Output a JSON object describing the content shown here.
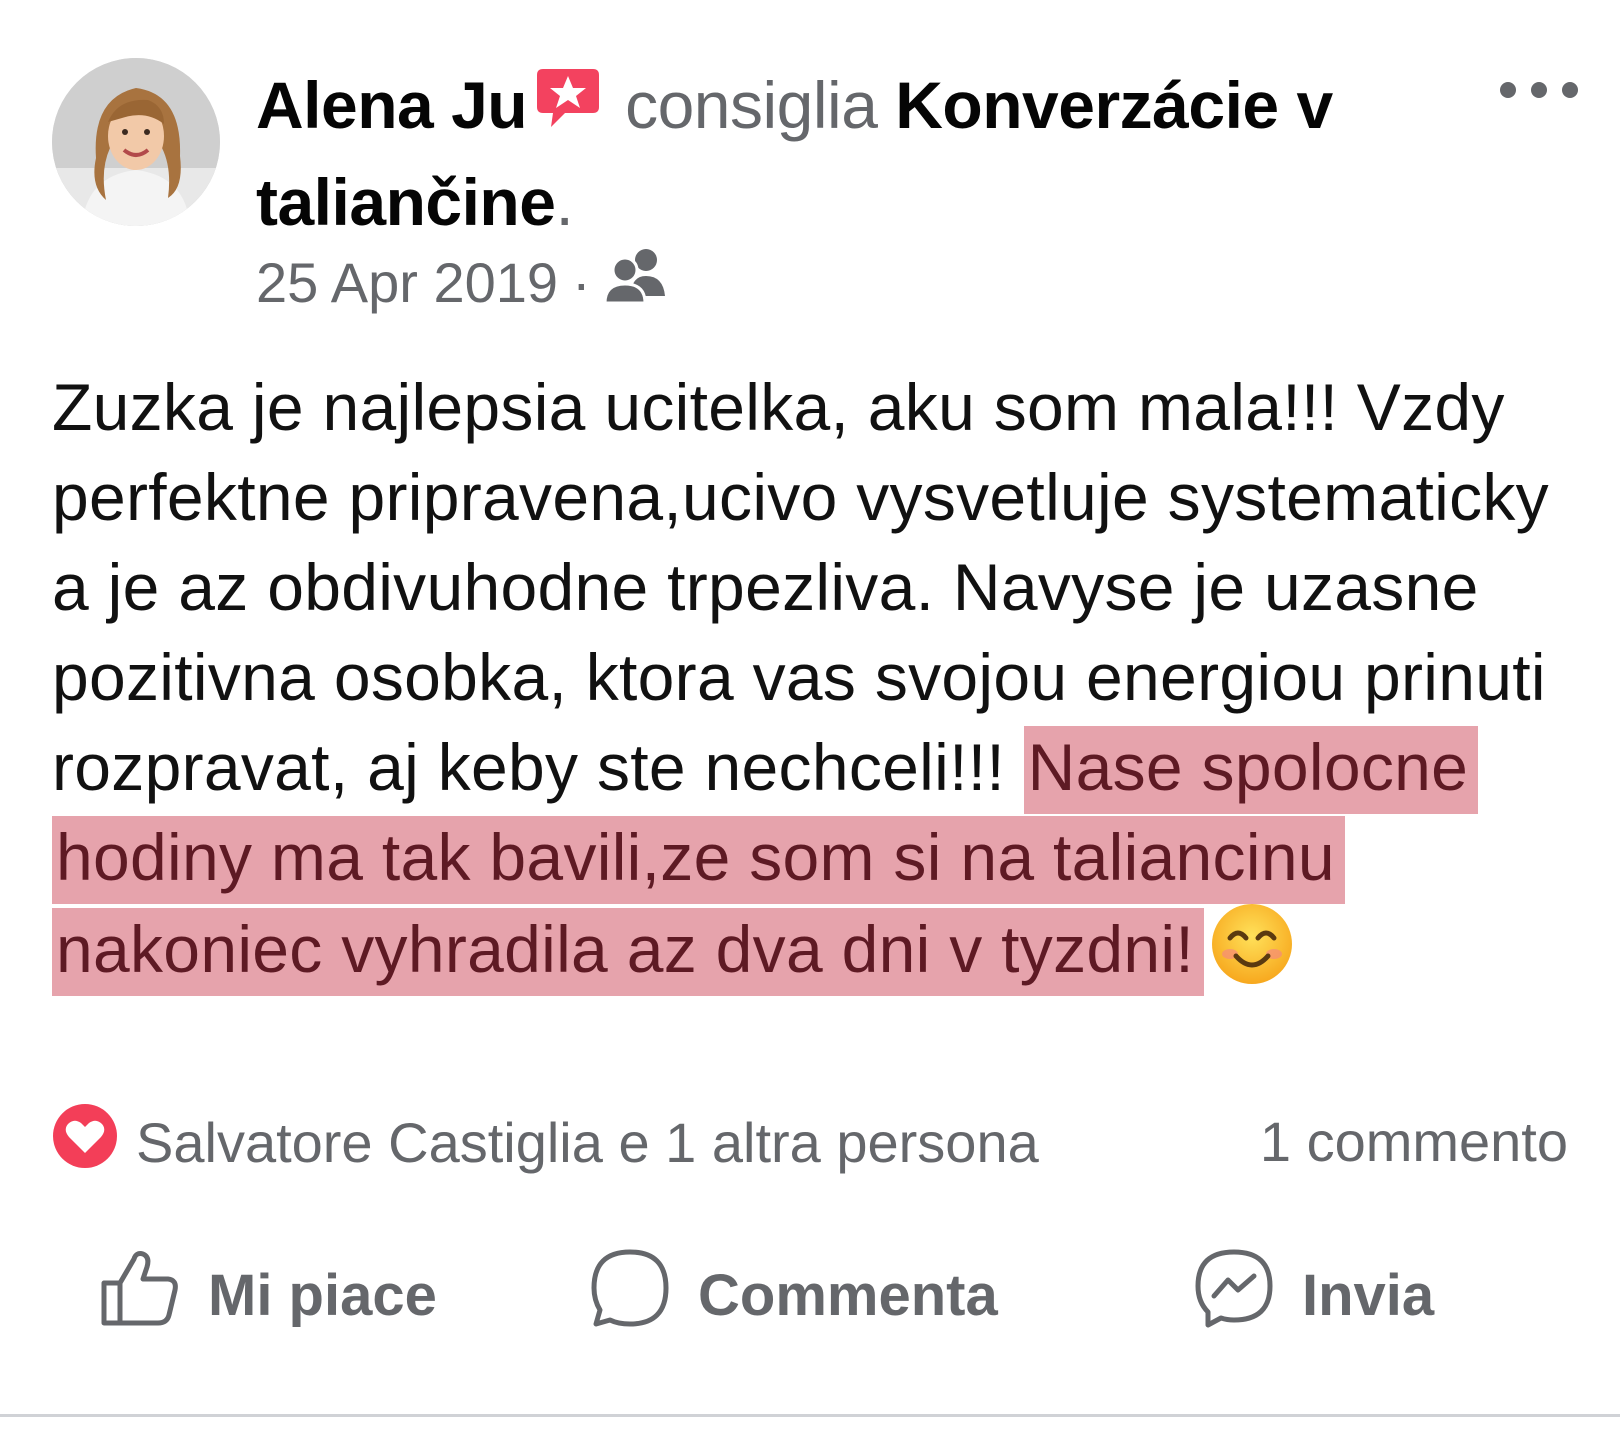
{
  "post": {
    "author": "Alena Ju",
    "verb": "consiglia",
    "page_name": "Konverzácie v taliančine",
    "period": ".",
    "date": "25 Apr 2019",
    "separator": "·",
    "audience_icon": "friends-icon",
    "more_icon": "more-options-icon",
    "body_plain": "Zuzka je najlepsia ucitelka, aku som mala!!! Vzdy perfektne  pripravena,ucivo vysvetluje systematicky a je az obdivuhodne trpezliva. Navyse je uzasne pozitivna osobka, ktora vas svojou energiou prinuti rozpravat, aj keby ste nechceli!!!",
    "body_highlight": "Nase spolocne hodiny ma tak bavili,ze som si na taliancinu nakoniec vyhradila az dva dni v tyzdni!",
    "highlight_color": "#e6a3ac",
    "emoji_icon": "smiling-face-emoji"
  },
  "reactions": {
    "icon": "love-reaction-icon",
    "text": "Salvatore Castiglia e 1 altra persona",
    "comments": "1 commento"
  },
  "actions": {
    "like": "Mi piace",
    "comment": "Commenta",
    "send": "Invia"
  },
  "colors": {
    "text": "#050505",
    "secondary": "#65676b",
    "love": "#f33e58",
    "recommend_badge": "#f3425f"
  }
}
